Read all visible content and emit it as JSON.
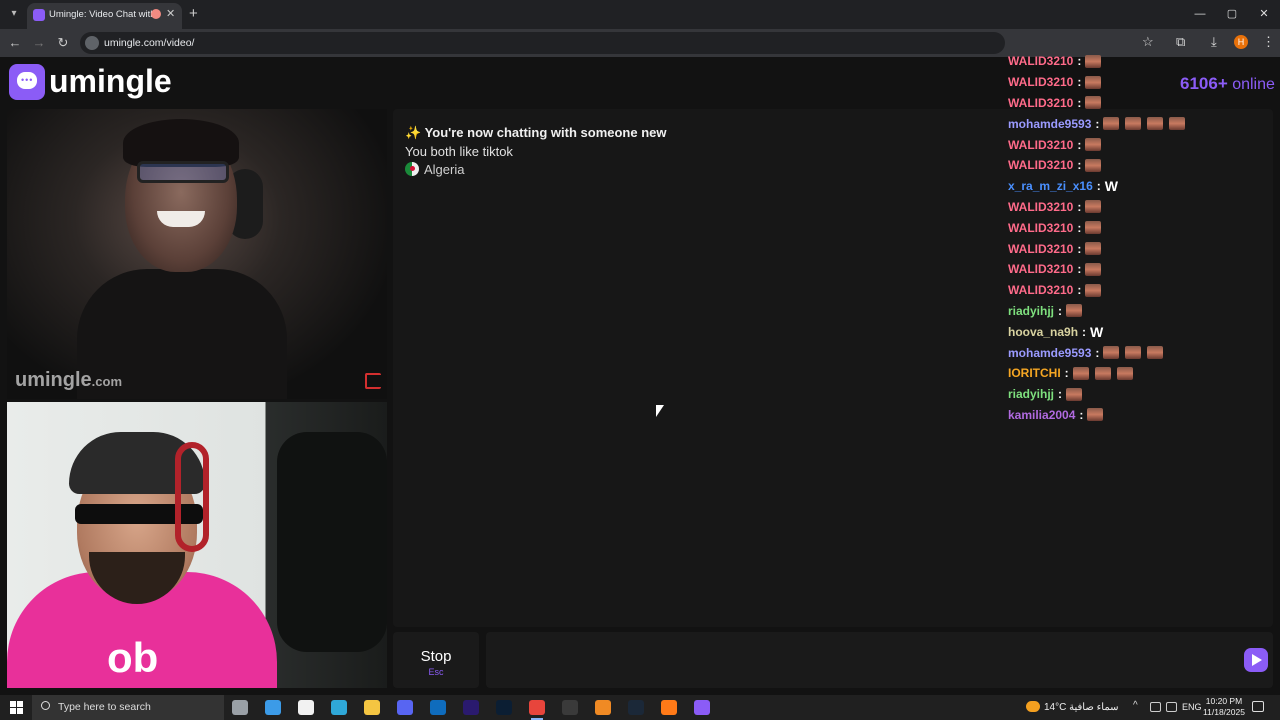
{
  "browser": {
    "tab_title": "Umingle: Video Chat with S",
    "tab_close": "✕",
    "new_tab": "+",
    "url": "umingle.com/video/",
    "window_controls": [
      "—",
      "▢",
      "✕"
    ]
  },
  "app": {
    "logo_text": "umingle",
    "online_count": "6106+",
    "online_label": "online",
    "watermark_brand": "umingle",
    "watermark_tld": ".com"
  },
  "chat": {
    "system_title": "✨ You're now chatting with someone new",
    "common_interest": "You both like tiktok",
    "country": "Algeria",
    "input_placeholder": ""
  },
  "controls": {
    "stop_label": "Stop",
    "stop_hint": "Esc"
  },
  "live_chat": [
    {
      "user": "WALID3210",
      "color": "#ff6b8a",
      "emotes": [
        "img"
      ]
    },
    {
      "user": "WALID3210",
      "color": "#ff6b8a",
      "emotes": [
        "img"
      ]
    },
    {
      "user": "WALID3210",
      "color": "#ff6b8a",
      "emotes": [
        "img"
      ]
    },
    {
      "user": "mohamde9593",
      "color": "#9b9bff",
      "emotes": [
        "img",
        "img",
        "img",
        "img"
      ]
    },
    {
      "user": "WALID3210",
      "color": "#ff6b8a",
      "emotes": [
        "img"
      ]
    },
    {
      "user": "WALID3210",
      "color": "#ff6b8a",
      "emotes": [
        "img"
      ]
    },
    {
      "user": "x_ra_m_zi_x16",
      "color": "#4a90ff",
      "emotes": [
        "W"
      ]
    },
    {
      "user": "WALID3210",
      "color": "#ff6b8a",
      "emotes": [
        "img"
      ]
    },
    {
      "user": "WALID3210",
      "color": "#ff6b8a",
      "emotes": [
        "img"
      ]
    },
    {
      "user": "WALID3210",
      "color": "#ff6b8a",
      "emotes": [
        "img"
      ]
    },
    {
      "user": "WALID3210",
      "color": "#ff6b8a",
      "emotes": [
        "img"
      ]
    },
    {
      "user": "WALID3210",
      "color": "#ff6b8a",
      "emotes": [
        "img"
      ]
    },
    {
      "user": "riadyihjj",
      "color": "#7ee07e",
      "emotes": [
        "img"
      ]
    },
    {
      "user": "hoova_na9h",
      "color": "#d8d2a0",
      "emotes": [
        "W"
      ]
    },
    {
      "user": "mohamde9593",
      "color": "#9b9bff",
      "emotes": [
        "img",
        "img",
        "img"
      ]
    },
    {
      "user": "IORITCHI",
      "color": "#f5a623",
      "emotes": [
        "img",
        "img",
        "img"
      ]
    },
    {
      "user": "riadyihjj",
      "color": "#7ee07e",
      "emotes": [
        "img"
      ]
    },
    {
      "user": "kamilia2004",
      "color": "#b06ae0",
      "emotes": [
        "img"
      ]
    }
  ],
  "taskbar": {
    "search_placeholder": "Type here to search",
    "weather": "14°C  سماء صافية",
    "language": "ENG",
    "time": "10:20 PM",
    "date": "11/18/2025",
    "apps": [
      {
        "name": "task-view",
        "color": "#9aa0a6"
      },
      {
        "name": "store",
        "color": "#3c9be8"
      },
      {
        "name": "file",
        "color": "#f1f1f1"
      },
      {
        "name": "edge",
        "color": "#2fa8d8"
      },
      {
        "name": "explorer",
        "color": "#f4c542"
      },
      {
        "name": "discord",
        "color": "#5865f2"
      },
      {
        "name": "outlook",
        "color": "#0f6cbd"
      },
      {
        "name": "premiere",
        "color": "#2a1a6e"
      },
      {
        "name": "photoshop",
        "color": "#0b1e33"
      },
      {
        "name": "chrome",
        "color": "#e8453c"
      },
      {
        "name": "obs",
        "color": "#3a3a3a"
      },
      {
        "name": "fl-studio",
        "color": "#f08a24"
      },
      {
        "name": "steam",
        "color": "#1b2838"
      },
      {
        "name": "app-orange",
        "color": "#ff7a18"
      },
      {
        "name": "twitch",
        "color": "#8b5cf6"
      }
    ]
  }
}
